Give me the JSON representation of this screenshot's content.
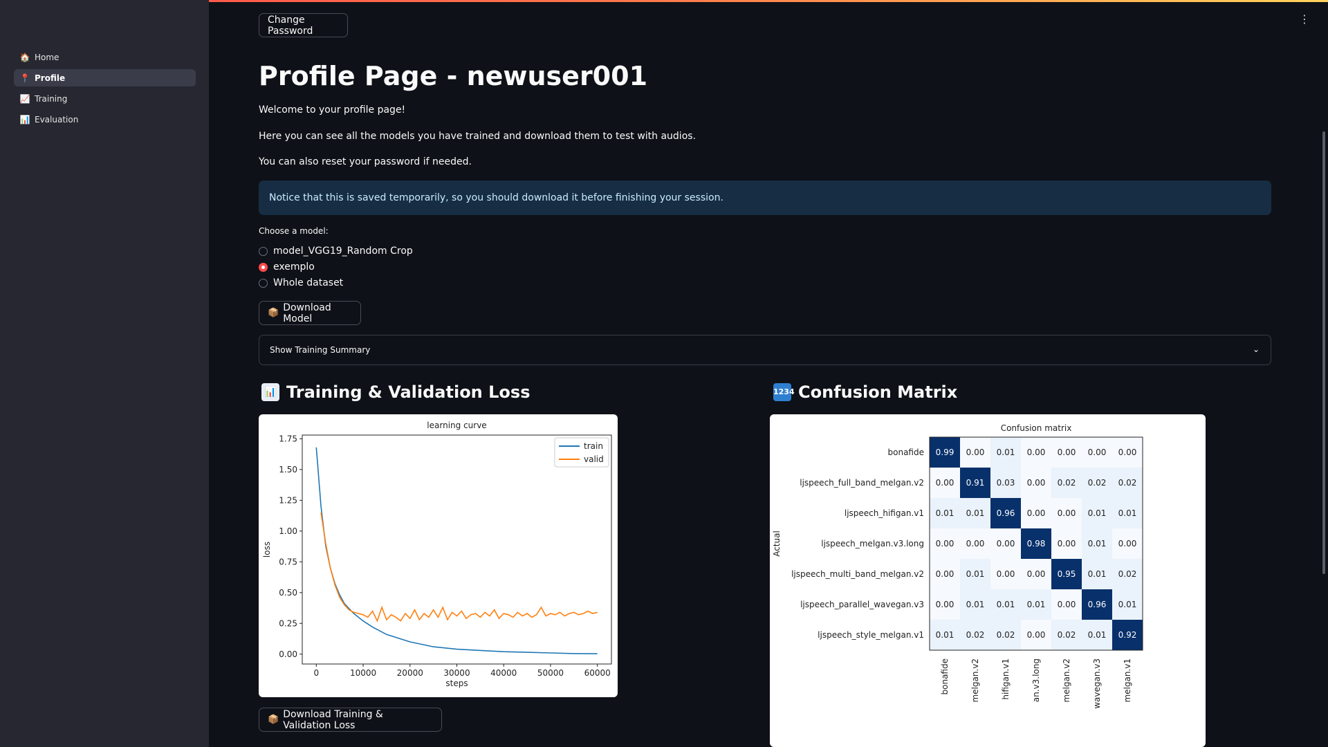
{
  "sidebar": {
    "items": [
      {
        "label": "Home",
        "icon": "house-icon",
        "active": false
      },
      {
        "label": "Profile",
        "icon": "pin-icon",
        "active": true
      },
      {
        "label": "Training",
        "icon": "chart-increasing-icon",
        "active": false
      },
      {
        "label": "Evaluation",
        "icon": "bar-chart-icon",
        "active": false
      }
    ]
  },
  "main": {
    "change_password_label": "Change Password",
    "title": "Profile Page - newuser001",
    "welcome": "Welcome to your profile page!",
    "intro": "Here you can see all the models you have trained and download them to test with audios.",
    "reset_note": "You can also reset your password if needed.",
    "notice": "Notice that this is saved temporarily, so you should download it before finishing your session.",
    "model_label": "Choose a model:",
    "models": [
      {
        "label": "model_VGG19_Random Crop",
        "selected": false
      },
      {
        "label": "exemplo",
        "selected": true
      },
      {
        "label": "Whole dataset",
        "selected": false
      }
    ],
    "download_model_label": "Download Model",
    "expander_label": "Show Training Summary",
    "loss_heading": "Training & Validation Loss",
    "confusion_heading": "Confusion Matrix",
    "download_loss_label": "Download Training & Validation Loss"
  },
  "colors": {
    "accent": "#ff4b4b",
    "train": "#1f77b4",
    "valid": "#ff7f0e",
    "notice_bg": "#172d43"
  },
  "chart_data": [
    {
      "type": "line",
      "title": "learning curve",
      "xlabel": "steps",
      "ylabel": "loss",
      "xlim": [
        -3000,
        63000
      ],
      "ylim": [
        -0.08,
        1.78
      ],
      "xticks": [
        0,
        10000,
        20000,
        30000,
        40000,
        50000,
        60000
      ],
      "yticks": [
        0.0,
        0.25,
        0.5,
        0.75,
        1.0,
        1.25,
        1.5,
        1.75
      ],
      "legend": "top-right",
      "series": [
        {
          "name": "train",
          "x": [
            0,
            1000,
            2000,
            3000,
            4000,
            5000,
            6000,
            8000,
            10000,
            12000,
            15000,
            20000,
            25000,
            30000,
            35000,
            40000,
            45000,
            50000,
            55000,
            60000
          ],
          "values": [
            1.68,
            1.2,
            0.88,
            0.7,
            0.57,
            0.48,
            0.41,
            0.33,
            0.27,
            0.22,
            0.16,
            0.1,
            0.06,
            0.04,
            0.03,
            0.02,
            0.015,
            0.01,
            0.005,
            0.003
          ]
        },
        {
          "name": "valid",
          "x": [
            1000,
            2000,
            3000,
            4000,
            5000,
            6000,
            7000,
            8000,
            9000,
            10000,
            11000,
            12000,
            13000,
            14000,
            15000,
            16000,
            17000,
            18000,
            19000,
            20000,
            21000,
            22000,
            23000,
            24000,
            25000,
            26000,
            27000,
            28000,
            29000,
            30000,
            31000,
            32000,
            33000,
            34000,
            35000,
            36000,
            37000,
            38000,
            39000,
            40000,
            41000,
            42000,
            43000,
            44000,
            45000,
            46000,
            47000,
            48000,
            49000,
            50000,
            51000,
            52000,
            53000,
            54000,
            55000,
            56000,
            57000,
            58000,
            59000,
            60000
          ],
          "values": [
            1.15,
            0.9,
            0.7,
            0.56,
            0.46,
            0.4,
            0.36,
            0.34,
            0.33,
            0.32,
            0.3,
            0.35,
            0.27,
            0.38,
            0.28,
            0.32,
            0.3,
            0.27,
            0.33,
            0.29,
            0.36,
            0.28,
            0.33,
            0.3,
            0.36,
            0.3,
            0.38,
            0.28,
            0.34,
            0.31,
            0.35,
            0.29,
            0.32,
            0.33,
            0.3,
            0.34,
            0.31,
            0.36,
            0.29,
            0.33,
            0.32,
            0.3,
            0.34,
            0.31,
            0.33,
            0.3,
            0.32,
            0.38,
            0.31,
            0.33,
            0.32,
            0.34,
            0.31,
            0.33,
            0.34,
            0.32,
            0.33,
            0.35,
            0.33,
            0.34
          ]
        }
      ]
    },
    {
      "type": "heatmap",
      "title": "Confusion matrix",
      "ylabel": "Actual",
      "rows": [
        "bonafide",
        "ljspeech_full_band_melgan.v2",
        "ljspeech_hifigan.v1",
        "ljspeech_melgan.v3.long",
        "ljspeech_multi_band_melgan.v2",
        "ljspeech_parallel_wavegan.v3",
        "ljspeech_style_melgan.v1"
      ],
      "columns_visible": [
        "bonafide",
        "melgan.v2",
        "hifigan.v1",
        "an.v3.long",
        "melgan.v2",
        "wavegan.v3",
        "melgan.v1"
      ],
      "values": [
        [
          0.99,
          0.0,
          0.01,
          0.0,
          0.0,
          0.0,
          0.0
        ],
        [
          0.0,
          0.91,
          0.03,
          0.0,
          0.02,
          0.02,
          0.02
        ],
        [
          0.01,
          0.01,
          0.96,
          0.0,
          0.0,
          0.01,
          0.01
        ],
        [
          0.0,
          0.0,
          0.0,
          0.98,
          0.0,
          0.01,
          0.0
        ],
        [
          0.0,
          0.01,
          0.0,
          0.0,
          0.95,
          0.01,
          0.02
        ],
        [
          0.0,
          0.01,
          0.01,
          0.01,
          0.0,
          0.96,
          0.01
        ],
        [
          0.01,
          0.02,
          0.02,
          0.0,
          0.02,
          0.01,
          0.92
        ]
      ]
    }
  ]
}
